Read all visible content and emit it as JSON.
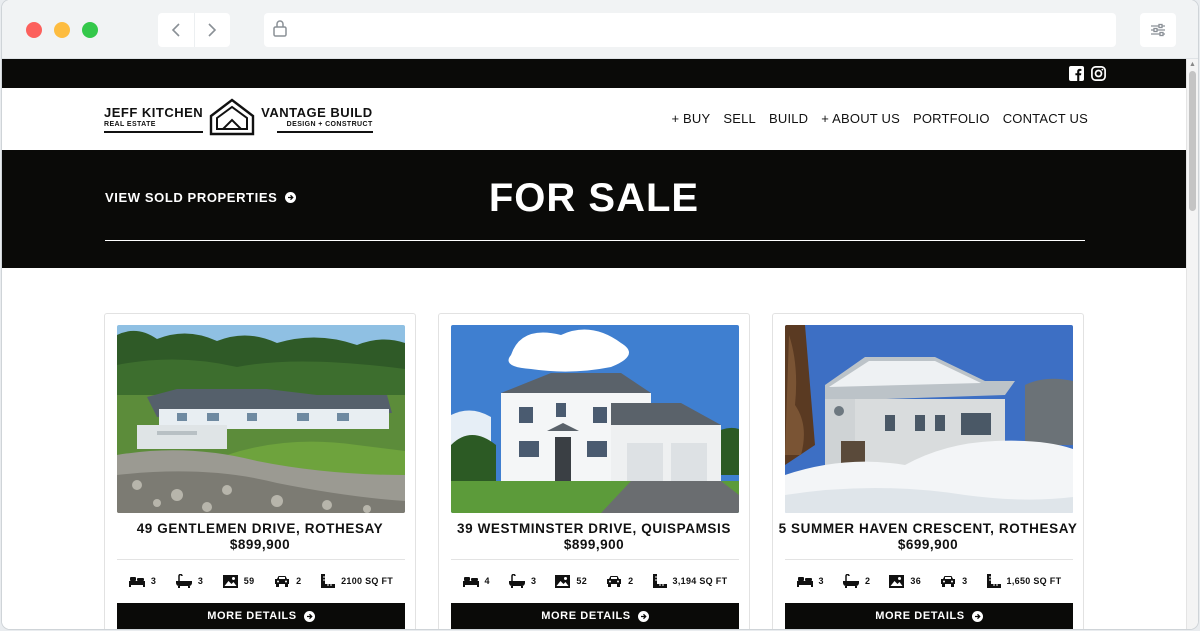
{
  "browser": {
    "back_icon": "chevron-left-icon",
    "forward_icon": "chevron-right-icon",
    "lock_icon": "lock-icon",
    "menu_icon": "sliders-icon"
  },
  "social": [
    "facebook-icon",
    "instagram-icon"
  ],
  "logo": {
    "left_main": "JEFF KITCHEN",
    "left_sub": "REAL ESTATE",
    "right_main": "VANTAGE BUILD",
    "right_sub": "DESIGN + CONSTRUCT"
  },
  "nav": [
    "+ BUY",
    "SELL",
    "BUILD",
    "+ ABOUT US",
    "PORTFOLIO",
    "CONTACT US"
  ],
  "banner": {
    "sold_link": "VIEW SOLD PROPERTIES",
    "title": "FOR SALE"
  },
  "listings": [
    {
      "address": "49 GENTLEMEN DRIVE, ROTHESAY",
      "price": "$899,900",
      "beds": "3",
      "baths": "3",
      "photos": "59",
      "garage": "2",
      "sqft": "2100 SQ FT",
      "button": "MORE DETAILS"
    },
    {
      "address": "39 WESTMINSTER DRIVE, QUISPAMSIS",
      "price": "$899,900",
      "beds": "4",
      "baths": "3",
      "photos": "52",
      "garage": "2",
      "sqft": "3,194 SQ FT",
      "button": "MORE DETAILS"
    },
    {
      "address": "5 SUMMER HAVEN CRESCENT, ROTHESAY",
      "price": "$699,900",
      "beds": "3",
      "baths": "2",
      "photos": "36",
      "garage": "3",
      "sqft": "1,650 SQ FT",
      "button": "MORE DETAILS"
    }
  ],
  "colors": {
    "dark_bar": "#0a0a08",
    "accent_text": "#ffffff"
  }
}
